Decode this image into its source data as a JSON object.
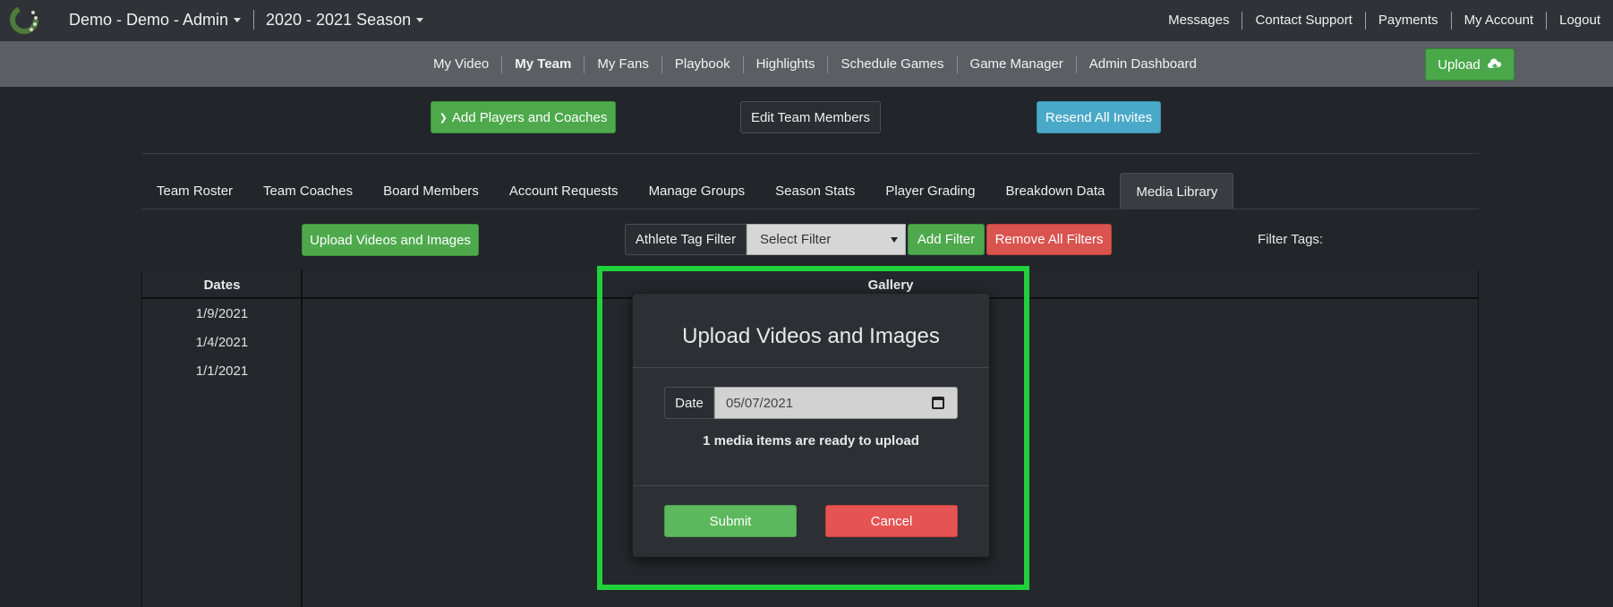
{
  "topbar": {
    "team_label": "Demo - Demo - Admin",
    "season_label": "2020 - 2021 Season",
    "nav": [
      "Messages",
      "Contact Support",
      "Payments",
      "My Account",
      "Logout"
    ]
  },
  "subnav": {
    "items": [
      "My Video",
      "My Team",
      "My Fans",
      "Playbook",
      "Highlights",
      "Schedule Games",
      "Game Manager",
      "Admin Dashboard"
    ],
    "active": "My Team",
    "upload_label": "Upload"
  },
  "actions": {
    "add_players": "Add Players and Coaches",
    "edit_team": "Edit Team Members",
    "resend_invites": "Resend All Invites"
  },
  "tabs": {
    "items": [
      "Team Roster",
      "Team Coaches",
      "Board Members",
      "Account Requests",
      "Manage Groups",
      "Season Stats",
      "Player Grading",
      "Breakdown Data",
      "Media Library"
    ],
    "active": "Media Library"
  },
  "media": {
    "upload_button": "Upload Videos and Images",
    "filter_label": "Athlete Tag Filter",
    "filter_select": "Select Filter",
    "add_filter": "Add Filter",
    "remove_filters": "Remove All Filters",
    "filter_tags": "Filter Tags:"
  },
  "table": {
    "dates_header": "Dates",
    "gallery_header": "Gallery",
    "dates": [
      "1/9/2021",
      "1/4/2021",
      "1/1/2021"
    ]
  },
  "modal": {
    "title": "Upload Videos and Images",
    "date_label": "Date",
    "date_value": "05/07/2021",
    "ready_text": "1 media items are ready to upload",
    "submit": "Submit",
    "cancel": "Cancel"
  },
  "colors": {
    "highlight": "#1fd13a",
    "success": "#5cb85c",
    "danger": "#e65353",
    "info": "#4aa9c8"
  }
}
